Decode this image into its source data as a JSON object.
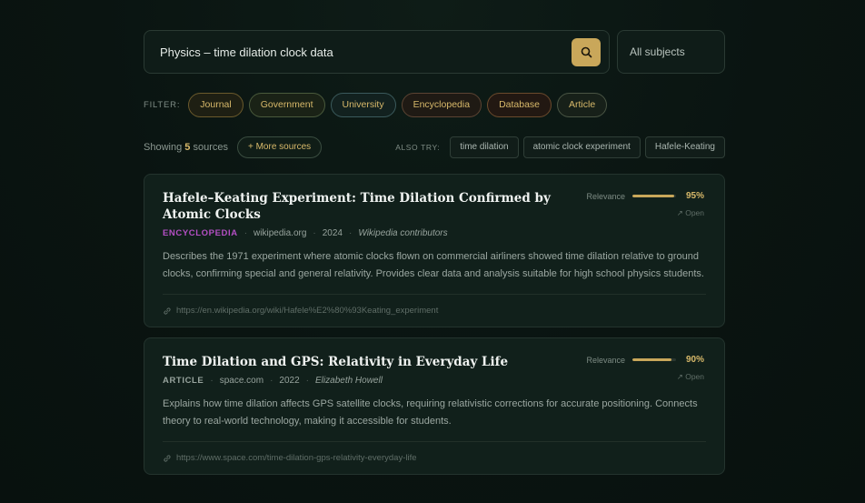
{
  "search": {
    "query": "Physics – time dilation clock data",
    "subject_select": "All subjects"
  },
  "filters": {
    "label": "FILTER:",
    "chips": [
      "Journal",
      "Government",
      "University",
      "Encyclopedia",
      "Database",
      "Article"
    ]
  },
  "results_bar": {
    "showing_prefix": "Showing",
    "count": "5",
    "showing_suffix": "sources",
    "more_button": "+ More sources",
    "also_try_label": "ALSO TRY:",
    "suggestions": [
      "time dilation",
      "atomic clock experiment",
      "Hafele-Keating"
    ]
  },
  "results": [
    {
      "title": "Hafele–Keating Experiment: Time Dilation Confirmed by Atomic Clocks",
      "type": "ENCYCLOPEDIA",
      "type_color": "#b44fc4",
      "domain": "wikipedia.org",
      "year": "2024",
      "author": "Wikipedia contributors",
      "description": "Describes the 1971 experiment where atomic clocks flown on commercial airliners showed time dilation relative to ground clocks, confirming special and general relativity. Provides clear data and analysis suitable for high school physics students.",
      "url": "https://en.wikipedia.org/wiki/Hafele%E2%80%93Keating_experiment",
      "relevance_label": "Relevance",
      "relevance": 95,
      "relevance_text": "95%",
      "open_label": "↗ Open"
    },
    {
      "title": "Time Dilation and GPS: Relativity in Everyday Life",
      "type": "ARTICLE",
      "type_color": "#97a39d",
      "domain": "space.com",
      "year": "2022",
      "author": "Elizabeth Howell",
      "description": "Explains how time dilation affects GPS satellite clocks, requiring relativistic corrections for accurate positioning. Connects theory to real-world technology, making it accessible for students.",
      "url": "https://www.space.com/time-dilation-gps-relativity-everyday-life",
      "relevance_label": "Relevance",
      "relevance": 90,
      "relevance_text": "90%",
      "open_label": "↗ Open"
    }
  ]
}
